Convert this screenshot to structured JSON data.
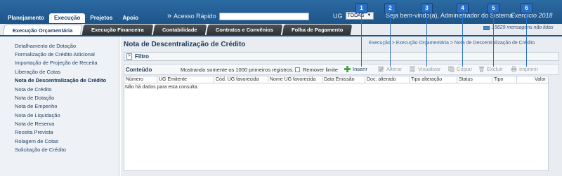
{
  "menu": [
    "Planejamento",
    "Execução",
    "Projetos",
    "Apoio"
  ],
  "quick_access": {
    "label": "Acesso Rápido",
    "arrow": "»",
    "value": ""
  },
  "ug": {
    "label": "UG",
    "selected": "TODAS",
    "caret": "▼"
  },
  "welcome": "Seja bem-vindo(a), Administrador do Sistema",
  "exercise": "Exercício 2018",
  "subtabs": [
    "Execução Orçamentária",
    "Execução Financeira",
    "Contabilidade",
    "Contratos e Convênios",
    "Folha de Pagamento"
  ],
  "messages": "15629 mensagens não lidas",
  "sidebar": [
    "Detalhamento de Dotação",
    "Formalização de Crédito Adicional",
    "Importação de Projeção de Receita",
    "Liberação de Cotas",
    "Nota de Descentralização de Crédito",
    "Nota de Crédito",
    "Nota de Dotação",
    "Nota de Empenho",
    "Nota de Liquidação",
    "Nota de Reserva",
    "Receita Prevista",
    "Rolagem de Cotas",
    "Solicitação de Crédito"
  ],
  "page": {
    "title": "Nota de Descentralização de Crédito",
    "breadcrumb": [
      "Execução",
      "Execução Orçamentária",
      "Nota de Descentralização de Crédito"
    ],
    "breadcrumb_sep": ">"
  },
  "filter": {
    "toggle": ">",
    "label": "Filtro"
  },
  "toolbar": {
    "content_label": "Conteúdo",
    "showing": "Mostrando somente os 1000 primeiros registros.",
    "remove_limit": "Remover limite",
    "tools": [
      {
        "label": "Inserir",
        "icon": "plus-icon",
        "enabled": true,
        "color": "#3aa335"
      },
      {
        "label": "Alterar",
        "icon": "edit-icon",
        "enabled": false,
        "color": "#b5bcc4"
      },
      {
        "label": "Visualizar",
        "icon": "view-icon",
        "enabled": false,
        "color": "#b5bcc4"
      },
      {
        "label": "Copiar",
        "icon": "copy-icon",
        "enabled": false,
        "color": "#b5bcc4"
      },
      {
        "label": "Excluir",
        "icon": "trash-icon",
        "enabled": false,
        "color": "#b5bcc4"
      },
      {
        "label": "Imprimir",
        "icon": "printer-icon",
        "enabled": false,
        "color": "#b5bcc4"
      }
    ]
  },
  "table": {
    "columns": [
      "Número",
      "UG Emitente",
      "Cód. UG favorecida",
      "Nome UG favorecida",
      "Data Emissão",
      "Doc. alterado",
      "Tipo alteração",
      "Status",
      "Tipo",
      "Valor"
    ],
    "empty": "Não há dados para esta consulta."
  },
  "callouts": [
    "1",
    "2",
    "3",
    "4",
    "5",
    "6"
  ],
  "colors": {
    "topbar": "#1d5488",
    "callout": "#2b6fc4",
    "insert": "#3aa335"
  }
}
